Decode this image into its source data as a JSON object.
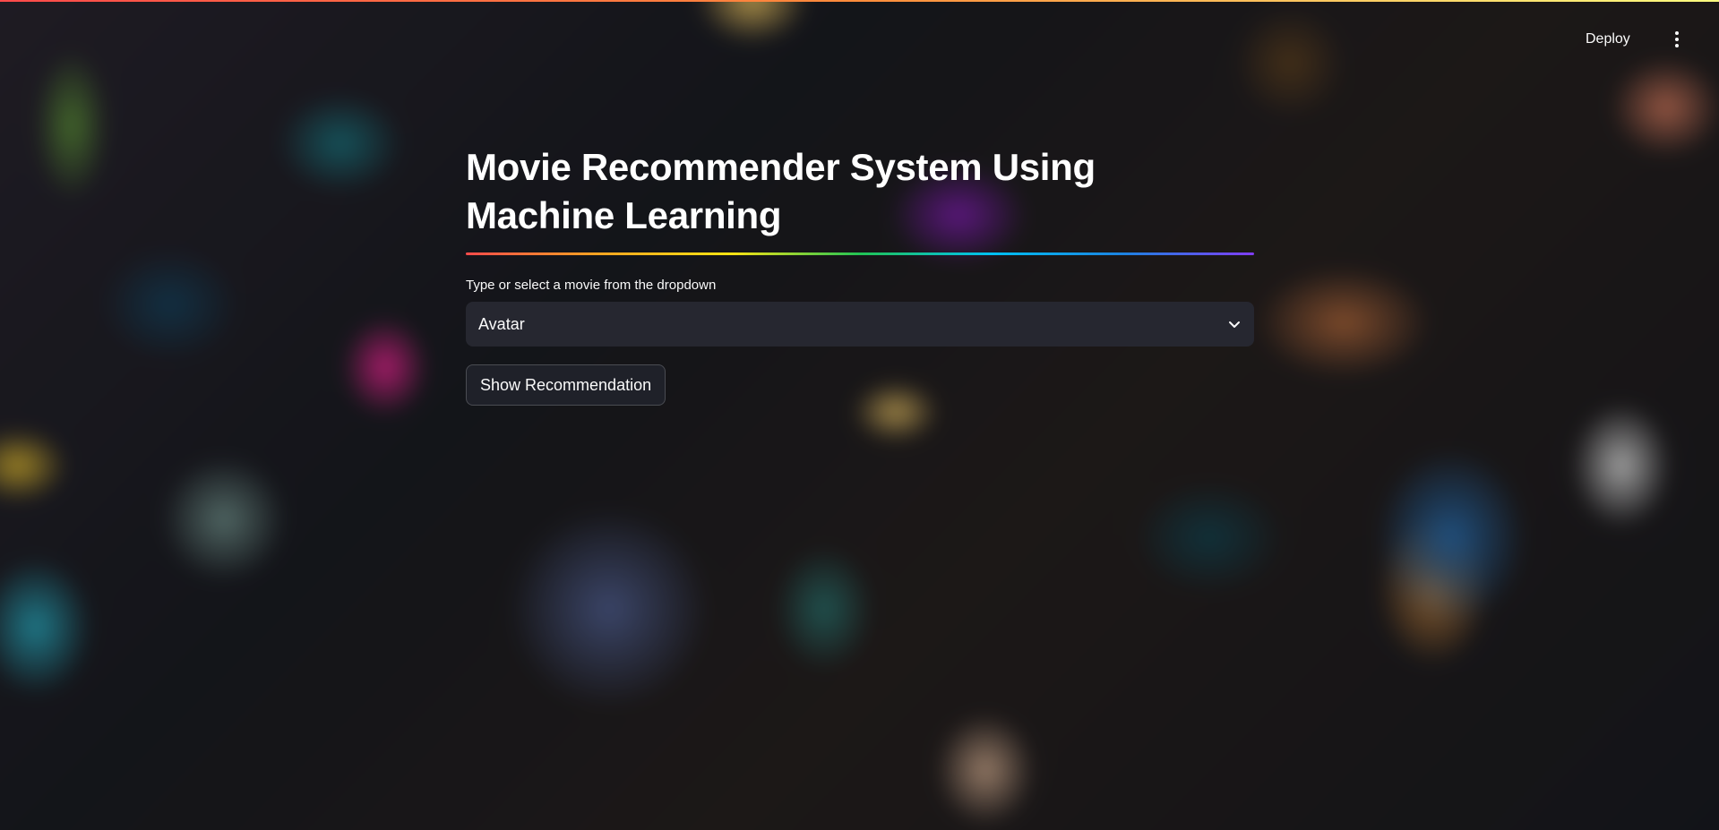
{
  "header": {
    "deploy_label": "Deploy",
    "menu_icon": "vertical-ellipsis-icon"
  },
  "main": {
    "title": "Movie Recommender System Using Machine Learning",
    "select": {
      "label": "Type or select a movie from the dropdown",
      "value": "Avatar",
      "icon": "chevron-down-icon"
    },
    "show_button_label": "Show Recommendation"
  },
  "colors": {
    "select_bg": "#262730",
    "button_bg": "#1f2129",
    "text": "#fafafa"
  }
}
